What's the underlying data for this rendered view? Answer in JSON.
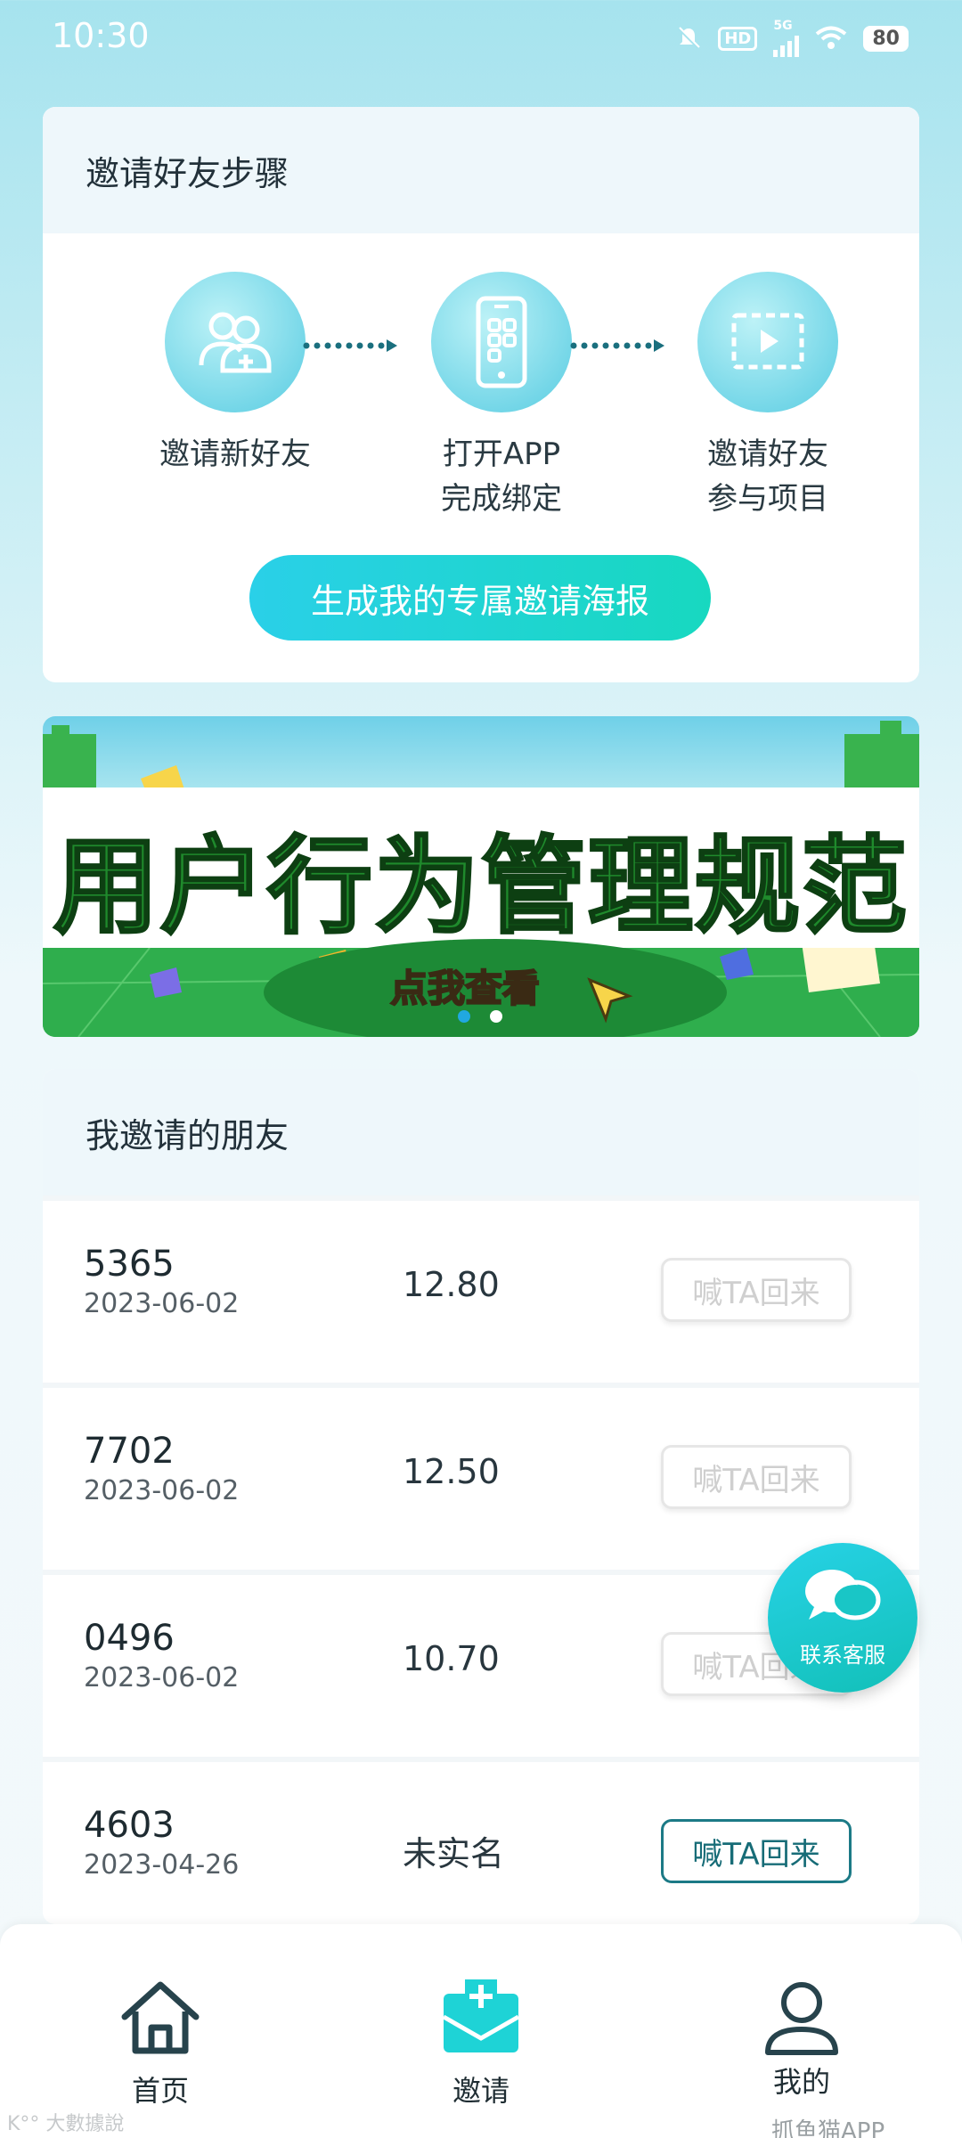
{
  "status_bar": {
    "time": "10:30",
    "network": "5G",
    "hd": "HD",
    "battery": "80"
  },
  "invite_steps": {
    "title": "邀请好友步骤",
    "steps": [
      {
        "line1": "邀请新好友",
        "line2": "",
        "icon": "add-user-icon"
      },
      {
        "line1": "打开APP",
        "line2": "完成绑定",
        "icon": "phone-app-icon"
      },
      {
        "line1": "邀请好友",
        "line2": "参与项目",
        "icon": "video-play-icon"
      }
    ],
    "generate_button": "生成我的专属邀请海报"
  },
  "banner": {
    "title": "用户行为管理规范",
    "cta": "点我查看",
    "page_count": 2,
    "active_page": 1
  },
  "friends": {
    "title": "我邀请的朋友",
    "rows": [
      {
        "id": "5365",
        "date": "2023-06-02",
        "amount": "12.80",
        "button": "喊TA回来",
        "enabled": false
      },
      {
        "id": "7702",
        "date": "2023-06-02",
        "amount": "12.50",
        "button": "喊TA回来",
        "enabled": false
      },
      {
        "id": "0496",
        "date": "2023-06-02",
        "amount": "10.70",
        "button": "喊TA回来",
        "enabled": false
      },
      {
        "id": "4603",
        "date": "2023-04-26",
        "amount": "未实名",
        "button": "喊TA回来",
        "enabled": true
      }
    ]
  },
  "customer_service": {
    "label": "联系客服"
  },
  "tab_bar": {
    "tabs": [
      {
        "label": "首页",
        "icon": "home-icon"
      },
      {
        "label": "邀请",
        "icon": "invite-envelope-icon",
        "active": true
      },
      {
        "label": "我的",
        "icon": "user-icon"
      }
    ]
  },
  "watermarks": {
    "left": "K°° 大數據說",
    "right": "抓鱼猫APP"
  },
  "colors": {
    "accent": "#1ed3d6",
    "accent_dark": "#176c77",
    "banner_green": "#1f8a2c"
  }
}
